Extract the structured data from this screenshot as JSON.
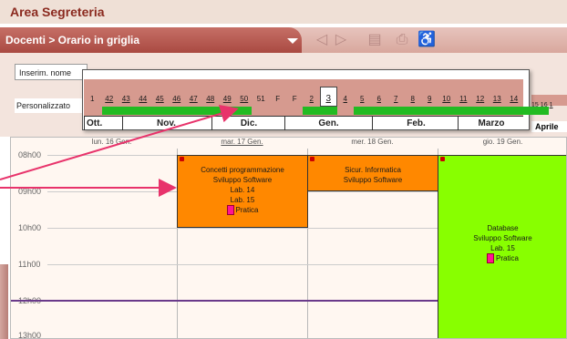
{
  "app": {
    "title": "Area Segreteria"
  },
  "toolbar": {
    "breadcrumb": "Docenti > Orario in griglia",
    "icons": [
      "prev-icon",
      "next-icon",
      "document-icon",
      "print-icon",
      "accessibility-icon"
    ]
  },
  "filters": {
    "name_placeholder": "Inserim. nome",
    "view_select": "Personalizzato"
  },
  "week_picker": {
    "weeks": [
      "1",
      "42",
      "43",
      "44",
      "45",
      "46",
      "47",
      "48",
      "49",
      "50",
      "51",
      "F",
      "F",
      "2",
      "3",
      "4",
      "5",
      "6",
      "7",
      "8",
      "9",
      "10",
      "11",
      "12",
      "13",
      "14"
    ],
    "selected_week": "3",
    "months": [
      "Ott.",
      "Nov.",
      "Dic.",
      "Gen.",
      "Feb.",
      "Marzo"
    ],
    "extra_weeks": [
      "15",
      "16",
      "1"
    ],
    "extra_month": "Aprile",
    "colors": {
      "strip": "#d69a8f",
      "green": "#22bb22"
    }
  },
  "calendar": {
    "days": [
      "lun. 16 Gen.",
      "mar. 17 Gen.",
      "mer. 18 Gen.",
      "gio. 19 Gen."
    ],
    "hours": [
      "08h00",
      "09h00",
      "10h00",
      "11h00",
      "12h00",
      "13h00"
    ],
    "events": [
      {
        "title": "Concetti programmazione",
        "course": "Sviluppo Software",
        "room1": "Lab. 14",
        "room2": "Lab. 15",
        "type": "Pratica",
        "color": "#ff8800"
      },
      {
        "title": "Sicur. Informatica",
        "course": "Sviluppo Software",
        "color": "#ff8800"
      },
      {
        "title": "Database",
        "course": "Sviluppo Software",
        "room1": "Lab. 15",
        "type": "Pratica",
        "color": "#88ff00"
      }
    ]
  }
}
